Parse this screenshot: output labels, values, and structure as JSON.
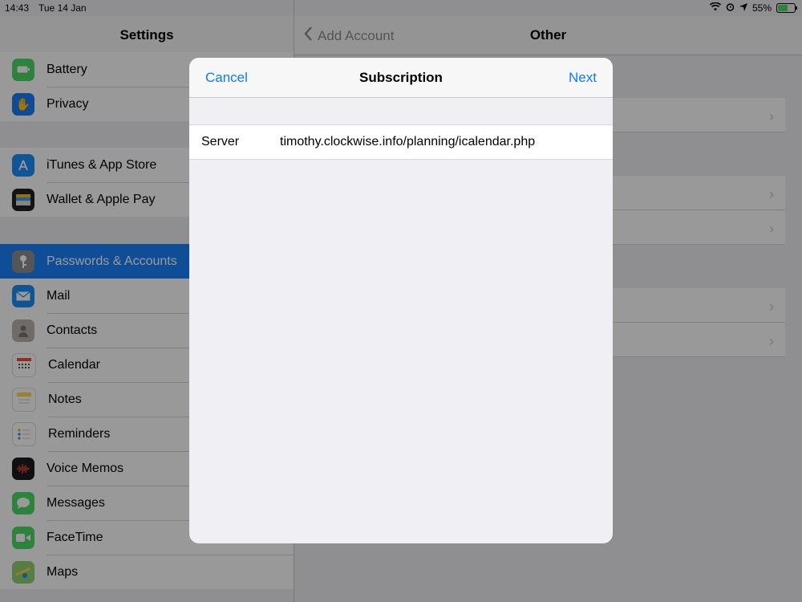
{
  "status_bar": {
    "time": "14:43",
    "date": "Tue 14 Jan",
    "battery": "55%"
  },
  "sidebar": {
    "title": "Settings",
    "groups": [
      {
        "items": [
          {
            "label": "Battery",
            "icon": "battery-icon",
            "color": "#4cd964"
          },
          {
            "label": "Privacy",
            "icon": "hand-icon",
            "color": "#1a7cf5"
          }
        ]
      },
      {
        "items": [
          {
            "label": "iTunes & App Store",
            "icon": "app-store-icon",
            "color": "#1c8ef9"
          },
          {
            "label": "Wallet & Apple Pay",
            "icon": "wallet-icon",
            "color": "#222222"
          }
        ]
      },
      {
        "items": [
          {
            "label": "Passwords & Accounts",
            "icon": "key-icon",
            "color": "#8e8e93",
            "selected": true
          },
          {
            "label": "Mail",
            "icon": "mail-icon",
            "color": "#1a8cf7"
          },
          {
            "label": "Contacts",
            "icon": "contacts-icon",
            "color": "#b9b2aa"
          },
          {
            "label": "Calendar",
            "icon": "calendar-icon",
            "color": "#ffffff"
          },
          {
            "label": "Notes",
            "icon": "notes-icon",
            "color": "#ffd84d"
          },
          {
            "label": "Reminders",
            "icon": "reminders-icon",
            "color": "#ffffff"
          },
          {
            "label": "Voice Memos",
            "icon": "voice-memos-icon",
            "color": "#1c1c1e"
          },
          {
            "label": "Messages",
            "icon": "messages-icon",
            "color": "#4cd964"
          },
          {
            "label": "FaceTime",
            "icon": "facetime-icon",
            "color": "#4cd964"
          },
          {
            "label": "Maps",
            "icon": "maps-icon",
            "color": "#8fd070"
          }
        ]
      }
    ]
  },
  "detail": {
    "back_label": "Add Account",
    "title": "Other"
  },
  "modal": {
    "cancel_label": "Cancel",
    "title": "Subscription",
    "next_label": "Next",
    "field": {
      "label": "Server",
      "value": "timothy.clockwise.info/planning/icalendar.php"
    }
  },
  "colors": {
    "accent": "#0a7aff",
    "selected": "#1a82fb"
  }
}
